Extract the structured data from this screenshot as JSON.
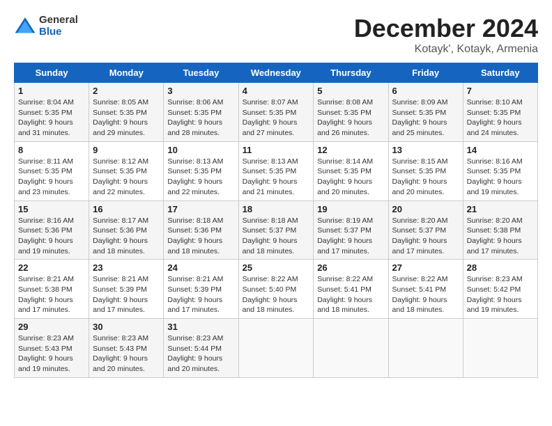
{
  "logo": {
    "text_general": "General",
    "text_blue": "Blue"
  },
  "header": {
    "month": "December 2024",
    "location": "Kotayk', Kotayk, Armenia"
  },
  "weekdays": [
    "Sunday",
    "Monday",
    "Tuesday",
    "Wednesday",
    "Thursday",
    "Friday",
    "Saturday"
  ],
  "weeks": [
    [
      {
        "day": "1",
        "sunrise": "8:04 AM",
        "sunset": "5:35 PM",
        "daylight": "9 hours and 31 minutes."
      },
      {
        "day": "2",
        "sunrise": "8:05 AM",
        "sunset": "5:35 PM",
        "daylight": "9 hours and 29 minutes."
      },
      {
        "day": "3",
        "sunrise": "8:06 AM",
        "sunset": "5:35 PM",
        "daylight": "9 hours and 28 minutes."
      },
      {
        "day": "4",
        "sunrise": "8:07 AM",
        "sunset": "5:35 PM",
        "daylight": "9 hours and 27 minutes."
      },
      {
        "day": "5",
        "sunrise": "8:08 AM",
        "sunset": "5:35 PM",
        "daylight": "9 hours and 26 minutes."
      },
      {
        "day": "6",
        "sunrise": "8:09 AM",
        "sunset": "5:35 PM",
        "daylight": "9 hours and 25 minutes."
      },
      {
        "day": "7",
        "sunrise": "8:10 AM",
        "sunset": "5:35 PM",
        "daylight": "9 hours and 24 minutes."
      }
    ],
    [
      {
        "day": "8",
        "sunrise": "8:11 AM",
        "sunset": "5:35 PM",
        "daylight": "9 hours and 23 minutes."
      },
      {
        "day": "9",
        "sunrise": "8:12 AM",
        "sunset": "5:35 PM",
        "daylight": "9 hours and 22 minutes."
      },
      {
        "day": "10",
        "sunrise": "8:13 AM",
        "sunset": "5:35 PM",
        "daylight": "9 hours and 22 minutes."
      },
      {
        "day": "11",
        "sunrise": "8:13 AM",
        "sunset": "5:35 PM",
        "daylight": "9 hours and 21 minutes."
      },
      {
        "day": "12",
        "sunrise": "8:14 AM",
        "sunset": "5:35 PM",
        "daylight": "9 hours and 20 minutes."
      },
      {
        "day": "13",
        "sunrise": "8:15 AM",
        "sunset": "5:35 PM",
        "daylight": "9 hours and 20 minutes."
      },
      {
        "day": "14",
        "sunrise": "8:16 AM",
        "sunset": "5:35 PM",
        "daylight": "9 hours and 19 minutes."
      }
    ],
    [
      {
        "day": "15",
        "sunrise": "8:16 AM",
        "sunset": "5:36 PM",
        "daylight": "9 hours and 19 minutes."
      },
      {
        "day": "16",
        "sunrise": "8:17 AM",
        "sunset": "5:36 PM",
        "daylight": "9 hours and 18 minutes."
      },
      {
        "day": "17",
        "sunrise": "8:18 AM",
        "sunset": "5:36 PM",
        "daylight": "9 hours and 18 minutes."
      },
      {
        "day": "18",
        "sunrise": "8:18 AM",
        "sunset": "5:37 PM",
        "daylight": "9 hours and 18 minutes."
      },
      {
        "day": "19",
        "sunrise": "8:19 AM",
        "sunset": "5:37 PM",
        "daylight": "9 hours and 17 minutes."
      },
      {
        "day": "20",
        "sunrise": "8:20 AM",
        "sunset": "5:37 PM",
        "daylight": "9 hours and 17 minutes."
      },
      {
        "day": "21",
        "sunrise": "8:20 AM",
        "sunset": "5:38 PM",
        "daylight": "9 hours and 17 minutes."
      }
    ],
    [
      {
        "day": "22",
        "sunrise": "8:21 AM",
        "sunset": "5:38 PM",
        "daylight": "9 hours and 17 minutes."
      },
      {
        "day": "23",
        "sunrise": "8:21 AM",
        "sunset": "5:39 PM",
        "daylight": "9 hours and 17 minutes."
      },
      {
        "day": "24",
        "sunrise": "8:21 AM",
        "sunset": "5:39 PM",
        "daylight": "9 hours and 17 minutes."
      },
      {
        "day": "25",
        "sunrise": "8:22 AM",
        "sunset": "5:40 PM",
        "daylight": "9 hours and 18 minutes."
      },
      {
        "day": "26",
        "sunrise": "8:22 AM",
        "sunset": "5:41 PM",
        "daylight": "9 hours and 18 minutes."
      },
      {
        "day": "27",
        "sunrise": "8:22 AM",
        "sunset": "5:41 PM",
        "daylight": "9 hours and 18 minutes."
      },
      {
        "day": "28",
        "sunrise": "8:23 AM",
        "sunset": "5:42 PM",
        "daylight": "9 hours and 19 minutes."
      }
    ],
    [
      {
        "day": "29",
        "sunrise": "8:23 AM",
        "sunset": "5:43 PM",
        "daylight": "9 hours and 19 minutes."
      },
      {
        "day": "30",
        "sunrise": "8:23 AM",
        "sunset": "5:43 PM",
        "daylight": "9 hours and 20 minutes."
      },
      {
        "day": "31",
        "sunrise": "8:23 AM",
        "sunset": "5:44 PM",
        "daylight": "9 hours and 20 minutes."
      },
      null,
      null,
      null,
      null
    ]
  ]
}
